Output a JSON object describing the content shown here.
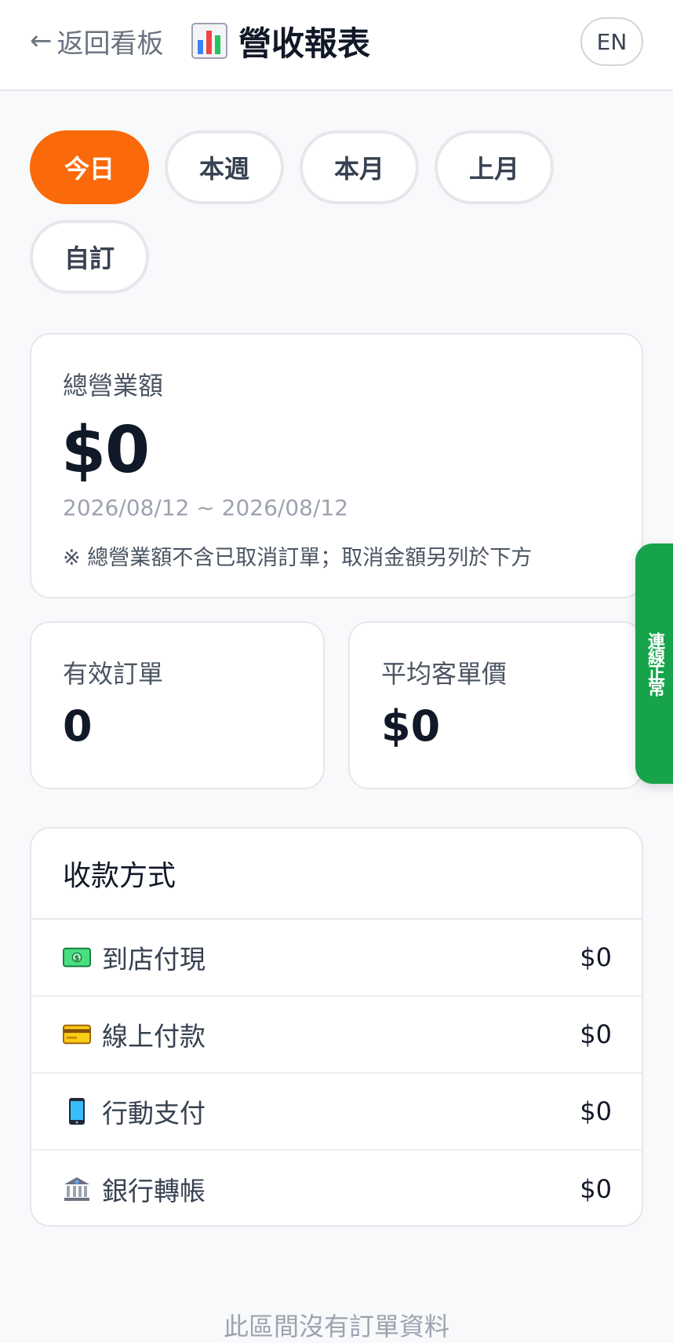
{
  "header": {
    "back_label": "返回看板",
    "title": "營收報表",
    "lang_button": "EN"
  },
  "period_tabs": [
    {
      "label": "今日",
      "active": true
    },
    {
      "label": "本週",
      "active": false
    },
    {
      "label": "本月",
      "active": false
    },
    {
      "label": "上月",
      "active": false
    },
    {
      "label": "自訂",
      "active": false
    }
  ],
  "summary": {
    "label": "總營業額",
    "amount": "$0",
    "date_range": "2026/08/12 ~ 2026/08/12",
    "note": "※ 總營業額不含已取消訂單；取消金額另列於下方"
  },
  "stats": {
    "valid_orders_label": "有效訂單",
    "valid_orders_value": "0",
    "avg_ticket_label": "平均客單價",
    "avg_ticket_value": "$0"
  },
  "payment_methods": {
    "title": "收款方式",
    "items": [
      {
        "icon": "cash-icon",
        "label": "到店付現",
        "amount": "$0"
      },
      {
        "icon": "credit-card-icon",
        "label": "線上付款",
        "amount": "$0"
      },
      {
        "icon": "mobile-phone-icon",
        "label": "行動支付",
        "amount": "$0"
      },
      {
        "icon": "bank-icon",
        "label": "銀行轉帳",
        "amount": "$0"
      }
    ]
  },
  "connection_status": "連線正常",
  "empty_message": "此區間沒有訂單資料",
  "colors": {
    "accent": "#fa6a0a",
    "status_ok": "#16a34a",
    "background": "#f8f9fb"
  }
}
